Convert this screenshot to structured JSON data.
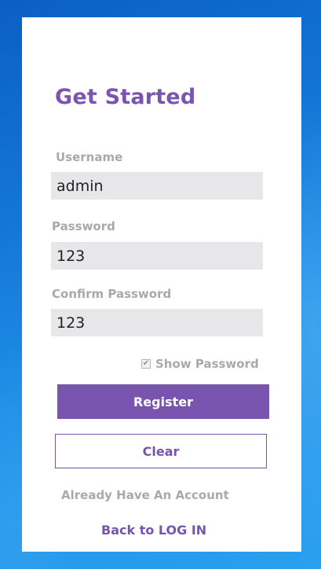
{
  "form": {
    "title": "Get Started",
    "username": {
      "label": "Username",
      "value": "admin"
    },
    "password": {
      "label": "Password",
      "value": "123"
    },
    "confirm_password": {
      "label": "Confirm Password",
      "value": "123"
    },
    "show_password": {
      "label": "Show Password",
      "checked": true
    },
    "register_label": "Register",
    "clear_label": "Clear",
    "already_have_account": "Already Have An Account",
    "back_to_login": "Back to LOG IN"
  },
  "colors": {
    "accent": "#7854ae",
    "label_gray": "#a9a9a9",
    "field_background": "#e7e7e9",
    "desktop_blue": "#1478d8"
  }
}
